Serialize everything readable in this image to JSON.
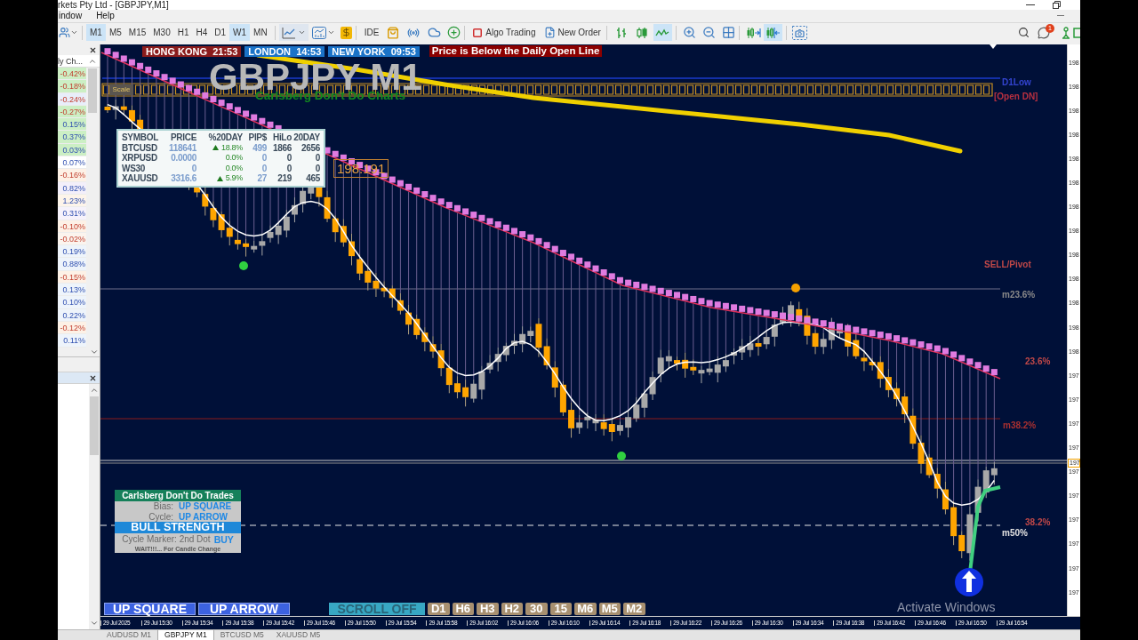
{
  "window": {
    "title": "rkets Pty Ltd - [GBPJPY,M1]"
  },
  "menu": [
    "indow",
    "Help"
  ],
  "toolbar": {
    "timeframes": [
      {
        "label": "M1",
        "selected": true
      },
      {
        "label": "M5",
        "selected": false
      },
      {
        "label": "M15",
        "selected": false
      },
      {
        "label": "M30",
        "selected": false
      },
      {
        "label": "H1",
        "selected": false
      },
      {
        "label": "H4",
        "selected": false
      },
      {
        "label": "D1",
        "selected": false
      },
      {
        "label": "W1",
        "selected": true
      },
      {
        "label": "MN",
        "selected": false
      }
    ],
    "ide": "IDE",
    "algo_trading": "Algo Trading",
    "new_order": "New Order",
    "chart_modes": [
      {
        "kind": "bars",
        "selected": false
      },
      {
        "kind": "candles",
        "selected": false
      },
      {
        "kind": "line",
        "selected": true
      }
    ],
    "view_toggles": [
      {
        "kind": "autoscroll",
        "selected": false
      },
      {
        "kind": "shift",
        "selected": true
      }
    ],
    "notification_badge": "1"
  },
  "market_watch": {
    "header": "ly Ch...",
    "items": [
      {
        "change": "-0.42%",
        "negative": true,
        "color": "#ccefc4"
      },
      {
        "change": "-0.18%",
        "negative": true,
        "color": "#ccefc4"
      },
      {
        "change": "-0.24%",
        "negative": true,
        "color": "#e8eefa"
      },
      {
        "change": "-0.27%",
        "negative": true,
        "color": "#ccefc4"
      },
      {
        "change": "0.15%",
        "negative": false,
        "color": "#ccefc4"
      },
      {
        "change": "0.37%",
        "negative": false,
        "color": "#ccefc4"
      },
      {
        "change": "0.03%",
        "negative": false,
        "color": "#ccefc4"
      },
      {
        "change": "0.07%",
        "negative": false,
        "color": "#ffffff"
      },
      {
        "change": "-0.16%",
        "negative": true,
        "color": "#fdf1e6"
      },
      {
        "change": "0.82%",
        "negative": false,
        "color": "#f3effa"
      },
      {
        "change": "1.23%",
        "negative": false,
        "color": "#fdf4ea"
      },
      {
        "change": "0.31%",
        "negative": false,
        "color": "#f6f2fb"
      },
      {
        "change": "-0.10%",
        "negative": true,
        "color": "#fdf1e6"
      },
      {
        "change": "-0.02%",
        "negative": true,
        "color": "#fbf4ee"
      },
      {
        "change": "0.19%",
        "negative": false,
        "color": "#eef4fb"
      },
      {
        "change": "0.88%",
        "negative": false,
        "color": "#eef4fb"
      },
      {
        "change": "-0.15%",
        "negative": true,
        "color": "#fdf1e6"
      },
      {
        "change": "0.13%",
        "negative": false,
        "color": "#eef4fb"
      },
      {
        "change": "0.10%",
        "negative": false,
        "color": "#eef4fb"
      },
      {
        "change": "0.22%",
        "negative": false,
        "color": "#eef4fb"
      },
      {
        "change": "-0.12%",
        "negative": true,
        "color": "#fdf1e6"
      },
      {
        "change": "0.11%",
        "negative": false,
        "color": "#eef4fb"
      }
    ]
  },
  "chart": {
    "session_clocks": [
      {
        "city": "HONG KONG",
        "time": "21:53",
        "color": "#8b1c1c"
      },
      {
        "city": "LONDON",
        "time": "14:53",
        "color": "#1b73c8"
      },
      {
        "city": "NEW YORK",
        "time": "09:53",
        "color": "#1b73c8"
      }
    ],
    "alert": "Price is Below the Daily Open Line",
    "symbol_title": "GBPJPY M1",
    "subtitle": "Carlsberg Don't Do Charts",
    "scale_button": "Scale",
    "price_tag": "198.191",
    "level_labels": [
      {
        "text": "D1Low",
        "color": "#3344d0"
      },
      {
        "text": "[Open DN]",
        "color": "#b83040"
      },
      {
        "text": "SELL/Pivot",
        "color": "#c04848"
      },
      {
        "text": "m23.6%",
        "color": "#8a8a8a"
      },
      {
        "text": "23.6%",
        "color": "#c04848"
      },
      {
        "text": "m38.2%",
        "color": "#a83030"
      },
      {
        "text": "38.2%",
        "color": "#c04848"
      },
      {
        "text": "m50%",
        "color": "#e0e0e0"
      }
    ],
    "symbols_table": {
      "columns": [
        "SYMBOL",
        "PRICE",
        "%20DAY",
        "PIP$",
        "HiLo",
        "20DAY"
      ],
      "rows": [
        {
          "symbol": "BTCUSD",
          "price": "118641",
          "rising": true,
          "change": "18.8%",
          "pips": "499",
          "hilo": "1866",
          "days20": "2656"
        },
        {
          "symbol": "XRPUSD",
          "price": "0.0000",
          "rising": false,
          "change": "0.0%",
          "pips": "0",
          "hilo": "0",
          "days20": "0"
        },
        {
          "symbol": "WS30",
          "price": "0",
          "rising": false,
          "change": "0.0%",
          "pips": "0",
          "hilo": "0",
          "days20": "0"
        },
        {
          "symbol": "XAUUSD",
          "price": "3316.6",
          "rising": true,
          "change": "5.9%",
          "pips": "27",
          "hilo": "219",
          "days20": "465"
        }
      ]
    },
    "signal_panel": {
      "title": "Carlsberg Don't Do Trades",
      "rows": [
        {
          "label": "Bias:",
          "value": "UP SQUARE"
        },
        {
          "label": "Cycle:",
          "value": "UP ARROW"
        }
      ],
      "strength": "BULL STRENGTH",
      "marker_label": "Cycle Marker: 2nd Dot",
      "marker_value": "BUY",
      "note": "WAIT!!!... For Candle Change"
    },
    "signal_buttons": [
      "UP SQUARE",
      "UP ARROW"
    ],
    "scroll_button": "SCROLL OFF",
    "timeframe_buttons": [
      "D1",
      "H6",
      "H3",
      "H2",
      "30",
      "15",
      "M6",
      "M5",
      "M2"
    ],
    "os_notice": "Activate Windows"
  },
  "price_axis": {
    "labels": [
      "198",
      "198",
      "198",
      "198",
      "198",
      "198",
      "198",
      "198",
      "198",
      "198",
      "198",
      "198",
      "198",
      "197",
      "197",
      "197",
      "197",
      "197",
      "197",
      "197",
      "197",
      "197",
      "197"
    ],
    "current": "197"
  },
  "time_axis": [
    "29 Jul 2025",
    "29 Jul 15:30",
    "29 Jul 15:34",
    "29 Jul 15:38",
    "29 Jul 15:42",
    "29 Jul 15:46",
    "29 Jul 15:50",
    "29 Jul 15:54",
    "29 Jul 15:58",
    "29 Jul 16:02",
    "29 Jul 16:06",
    "29 Jul 16:10",
    "29 Jul 16:14",
    "29 Jul 16:18",
    "29 Jul 16:22",
    "29 Jul 16:26",
    "29 Jul 16:30",
    "29 Jul 16:34",
    "29 Jul 16:38",
    "29 Jul 16:42",
    "29 Jul 16:46",
    "29 Jul 16:50",
    "29 Jul 16:54"
  ],
  "tabs": [
    {
      "label": "AUDUSD M1",
      "selected": false
    },
    {
      "label": "GBPJPY M1",
      "selected": true
    },
    {
      "label": "BTCUSD M5",
      "selected": false
    },
    {
      "label": "XAUUSD M5",
      "selected": false
    }
  ]
}
